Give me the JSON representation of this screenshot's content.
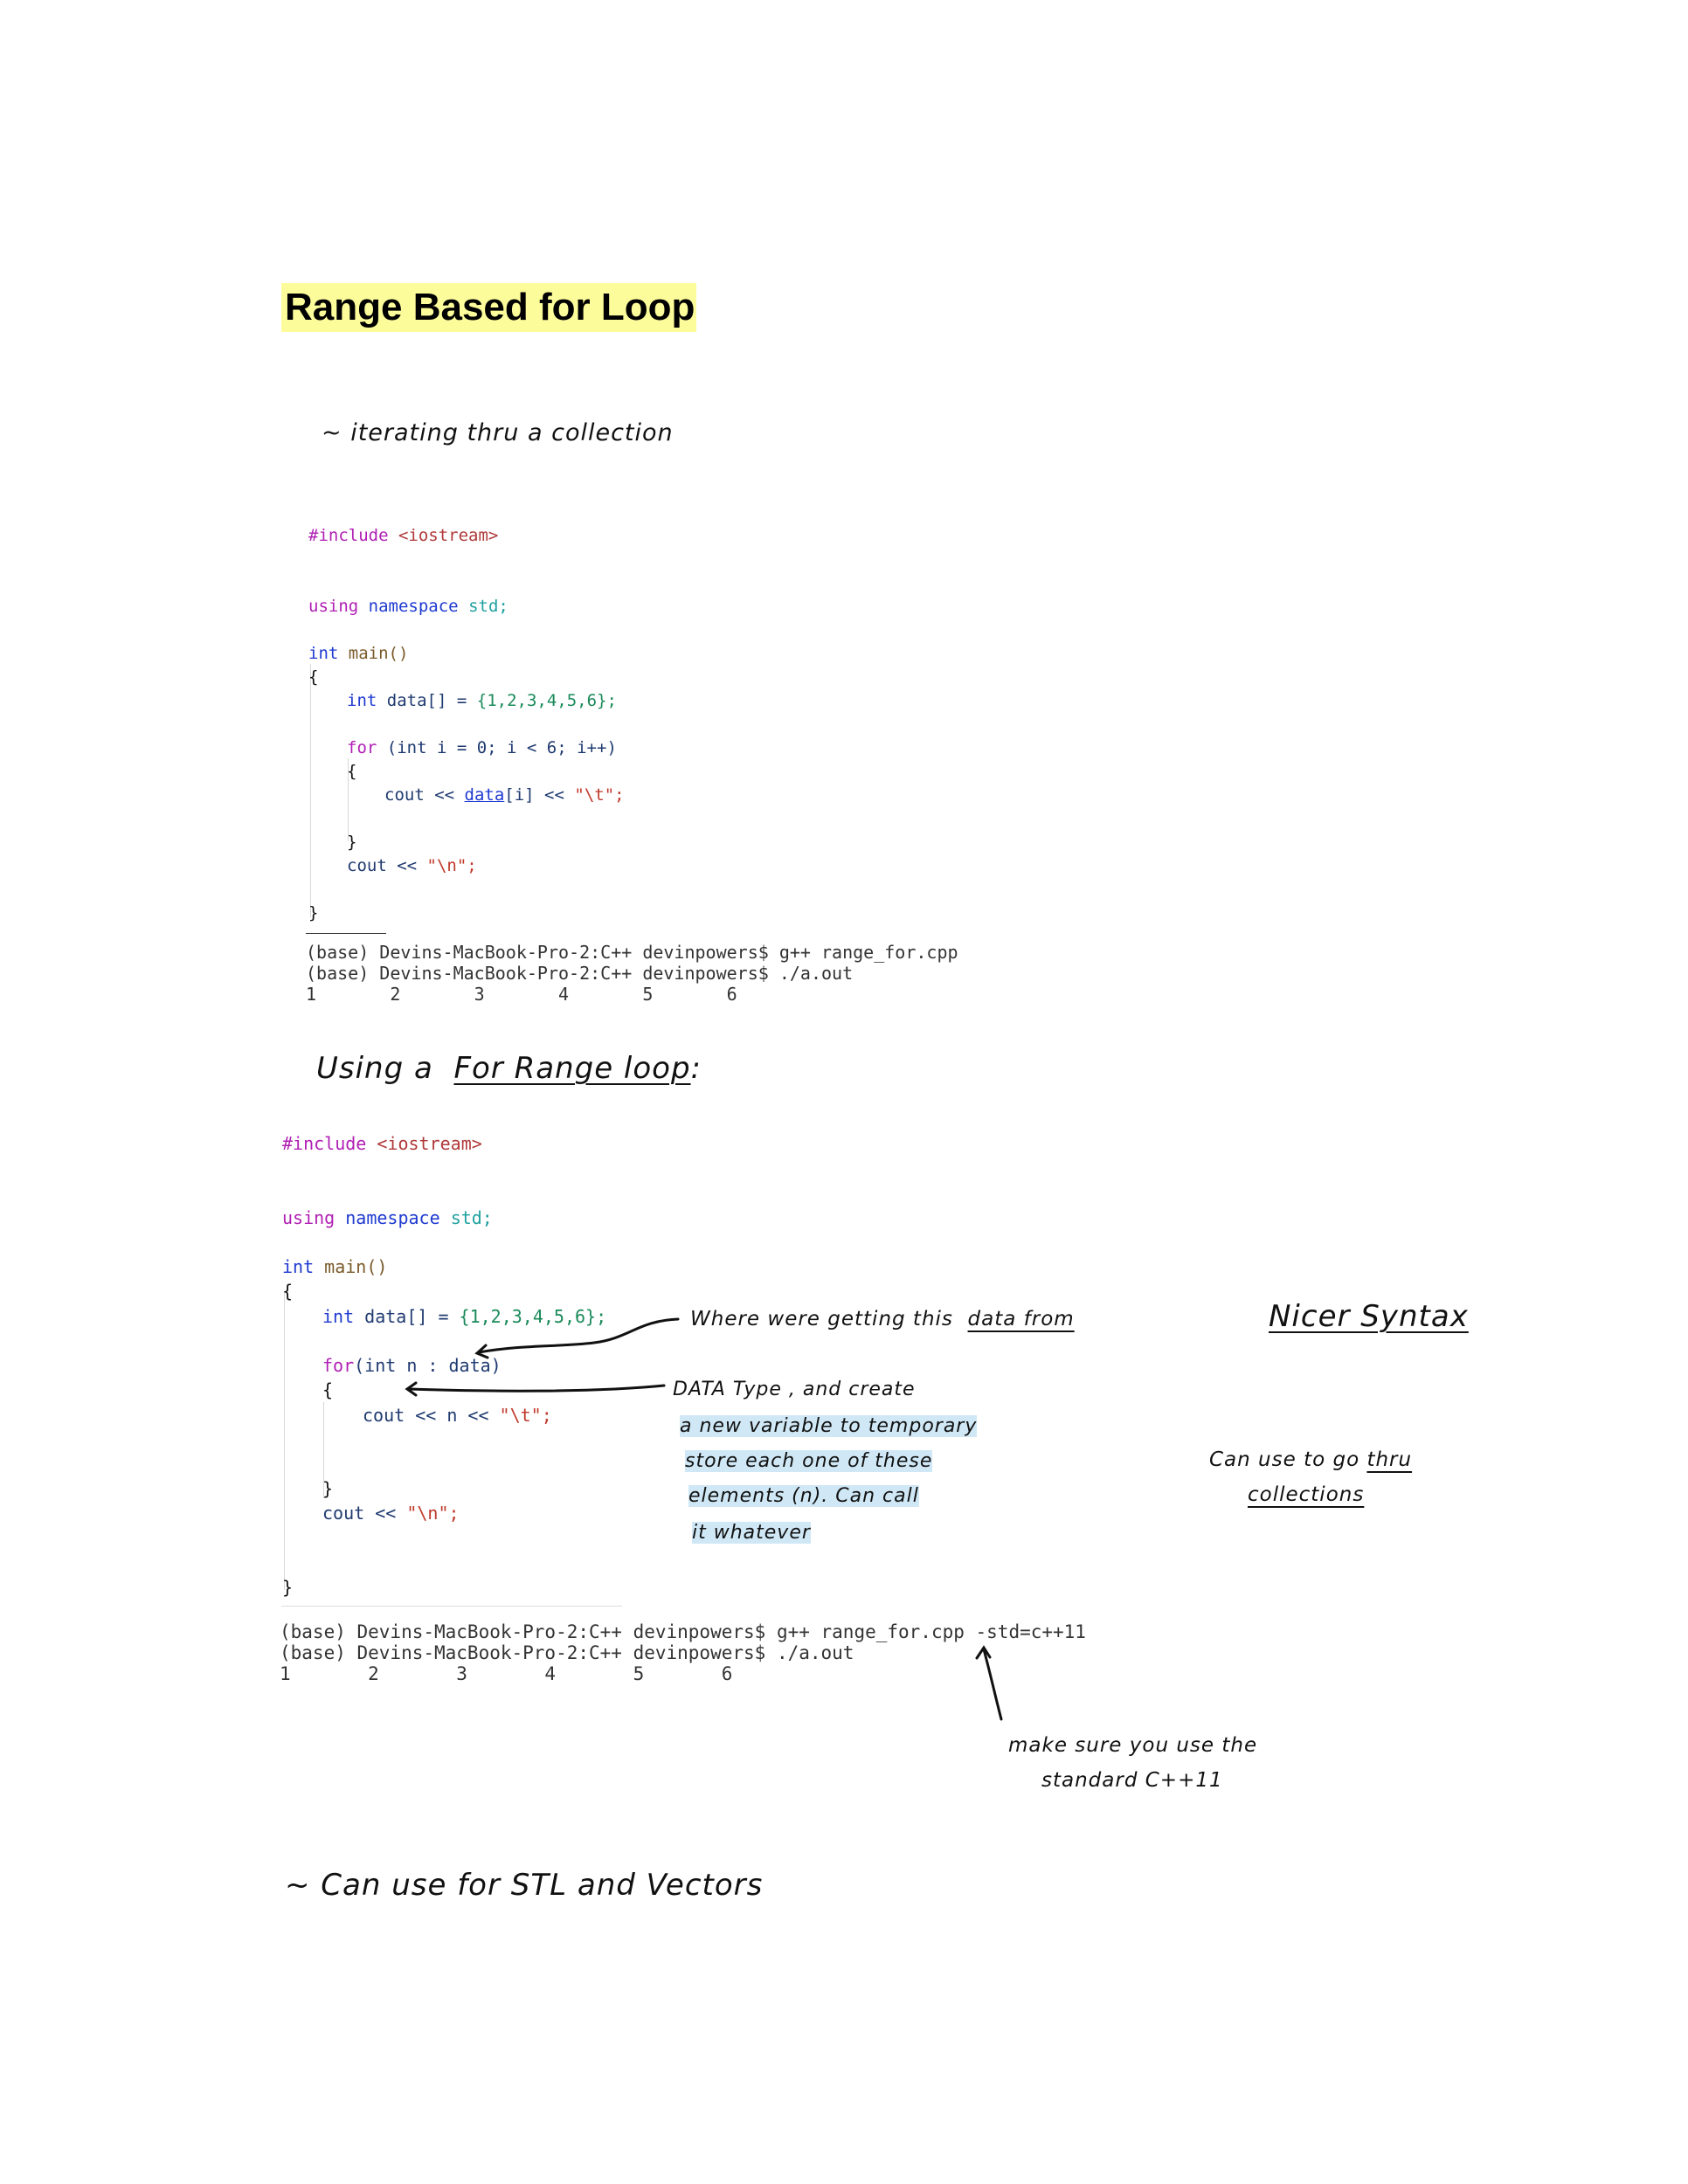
{
  "title": "Range Based for Loop",
  "notes": {
    "iterating": "~ iterating thru a collection",
    "using_range_loop_prefix": "Using a",
    "using_range_loop_underlined": "For Range loop",
    "using_range_loop_suffix": ":",
    "where_getting_data": "Where were getting this",
    "where_getting_data_ul": "data from",
    "nicer_syntax": "Nicer Syntax",
    "data_type_line1": "DATA Type , and create",
    "data_type_line2": "a new variable to temporary",
    "data_type_line3": "store each one of these",
    "data_type_line4": "elements (n). Can call",
    "data_type_line5": "it whatever",
    "can_use_line1_prefix": "Can use to go",
    "can_use_line1_ul": "thru",
    "can_use_line2": "collections",
    "make_sure_line1": "make sure you use the",
    "make_sure_line2": "standard C++11",
    "stl_vectors": "~ Can use for STL and Vectors"
  },
  "code1": {
    "include_directive": "#include",
    "include_header": "<iostream>",
    "using": "using",
    "namespace": "namespace",
    "std": "std;",
    "int_kw": "int",
    "main": "main()",
    "open_brace": "{",
    "data_decl_type": "int",
    "data_decl_name": "data[] =",
    "data_values": "{1,2,3,4,5,6};",
    "for_kw": "for",
    "for_cond": "(int i = 0; i < 6; i++)",
    "inner_open": "{",
    "cout_stmt_start": "cout <<",
    "cout_data": "data",
    "cout_index": "[i] <<",
    "cout_tab": "\"\\t\";",
    "inner_close": "}",
    "cout_newline_start": "cout <<",
    "cout_newline_str": "\"\\n\";",
    "close_brace": "}"
  },
  "terminal1": {
    "line1": "(base) Devins-MacBook-Pro-2:C++ devinpowers$ g++ range_for.cpp",
    "line2": "(base) Devins-MacBook-Pro-2:C++ devinpowers$ ./a.out",
    "line3": "1       2       3       4       5       6"
  },
  "code2": {
    "include_directive": "#include",
    "include_header": "<iostream>",
    "using": "using",
    "namespace": "namespace",
    "std": "std;",
    "int_kw": "int",
    "main": "main()",
    "open_brace": "{",
    "data_decl_type": "int",
    "data_decl_name": "data[] =",
    "data_values": "{1,2,3,4,5,6};",
    "for_kw": "for",
    "for_cond": "(int n : data)",
    "inner_open": "{",
    "cout_stmt": "cout << n <<",
    "cout_tab": "\"\\t\";",
    "inner_close": "}",
    "cout_newline_start": "cout <<",
    "cout_newline_str": "\"\\n\";",
    "close_brace": "}"
  },
  "terminal2": {
    "line1": "(base) Devins-MacBook-Pro-2:C++ devinpowers$ g++ range_for.cpp -std=c++11",
    "line2": "(base) Devins-MacBook-Pro-2:C++ devinpowers$ ./a.out",
    "line3": "1       2       3       4       5       6"
  }
}
